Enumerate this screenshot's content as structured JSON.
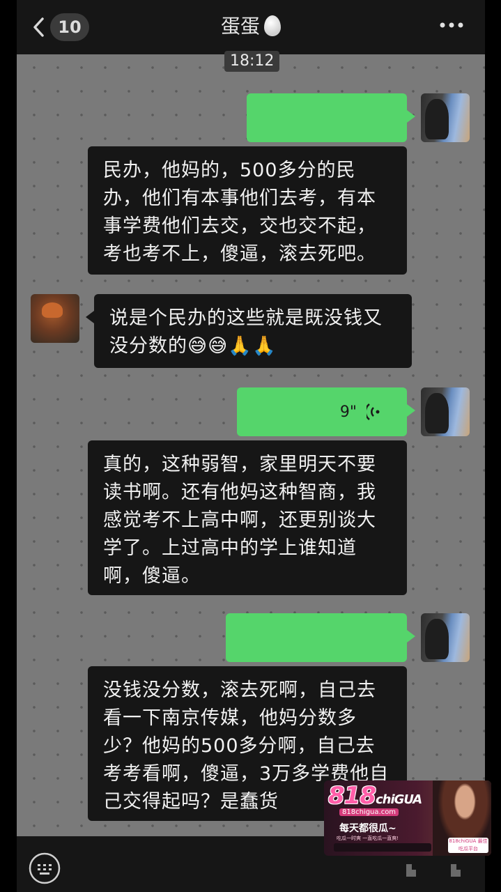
{
  "header": {
    "unread_count": "10",
    "contact_name": "蛋蛋",
    "more_icon": "more-dots-icon"
  },
  "time_label": "18:12",
  "messages": [
    {
      "side": "right",
      "kind": "voice",
      "duration": ""
    },
    {
      "side": "right",
      "kind": "transcription",
      "text": "民办，他妈的，500多分的民办，他们有本事他们去考，有本事学费他们去交，交也交不起，考也考不上，傻逼，滚去死吧。"
    },
    {
      "side": "left",
      "kind": "text",
      "text": "说是个民办的这些就是既没钱又没分数的",
      "emoji": [
        "grinning-sweat",
        "grinning-sweat",
        "pray",
        "pray"
      ]
    },
    {
      "side": "right",
      "kind": "voice",
      "duration": "9\""
    },
    {
      "side": "right",
      "kind": "transcription",
      "text": "真的，这种弱智，家里明天不要读书啊。还有他妈这种智商，我感觉考不上高中啊，还更别谈大学了。上过高中的学上谁知道啊，傻逼。"
    },
    {
      "side": "right",
      "kind": "voice",
      "duration": ""
    },
    {
      "side": "right",
      "kind": "transcription",
      "text": "没钱没分数，滚去死啊，自己去看一下南京传媒，他妈分数多少？他妈的500多分啊，自己去考考看啊，傻逼，3万多学费他自己交得起吗？是蠢货"
    }
  ],
  "watermark": {
    "logo_number": "818",
    "logo_word": "chiGUA",
    "site": "818chigua.com",
    "slogan": "每天都很瓜~",
    "tagline": "吃瓜一时爽 一直吃瓜一直爽!",
    "badge": "818chiGUA 最佳吃瓜平台"
  },
  "colors": {
    "chat_background": "#7a7a7a",
    "bar_background": "#161616",
    "green_bubble": "#55d56b",
    "transcription_bg": "#161616"
  }
}
